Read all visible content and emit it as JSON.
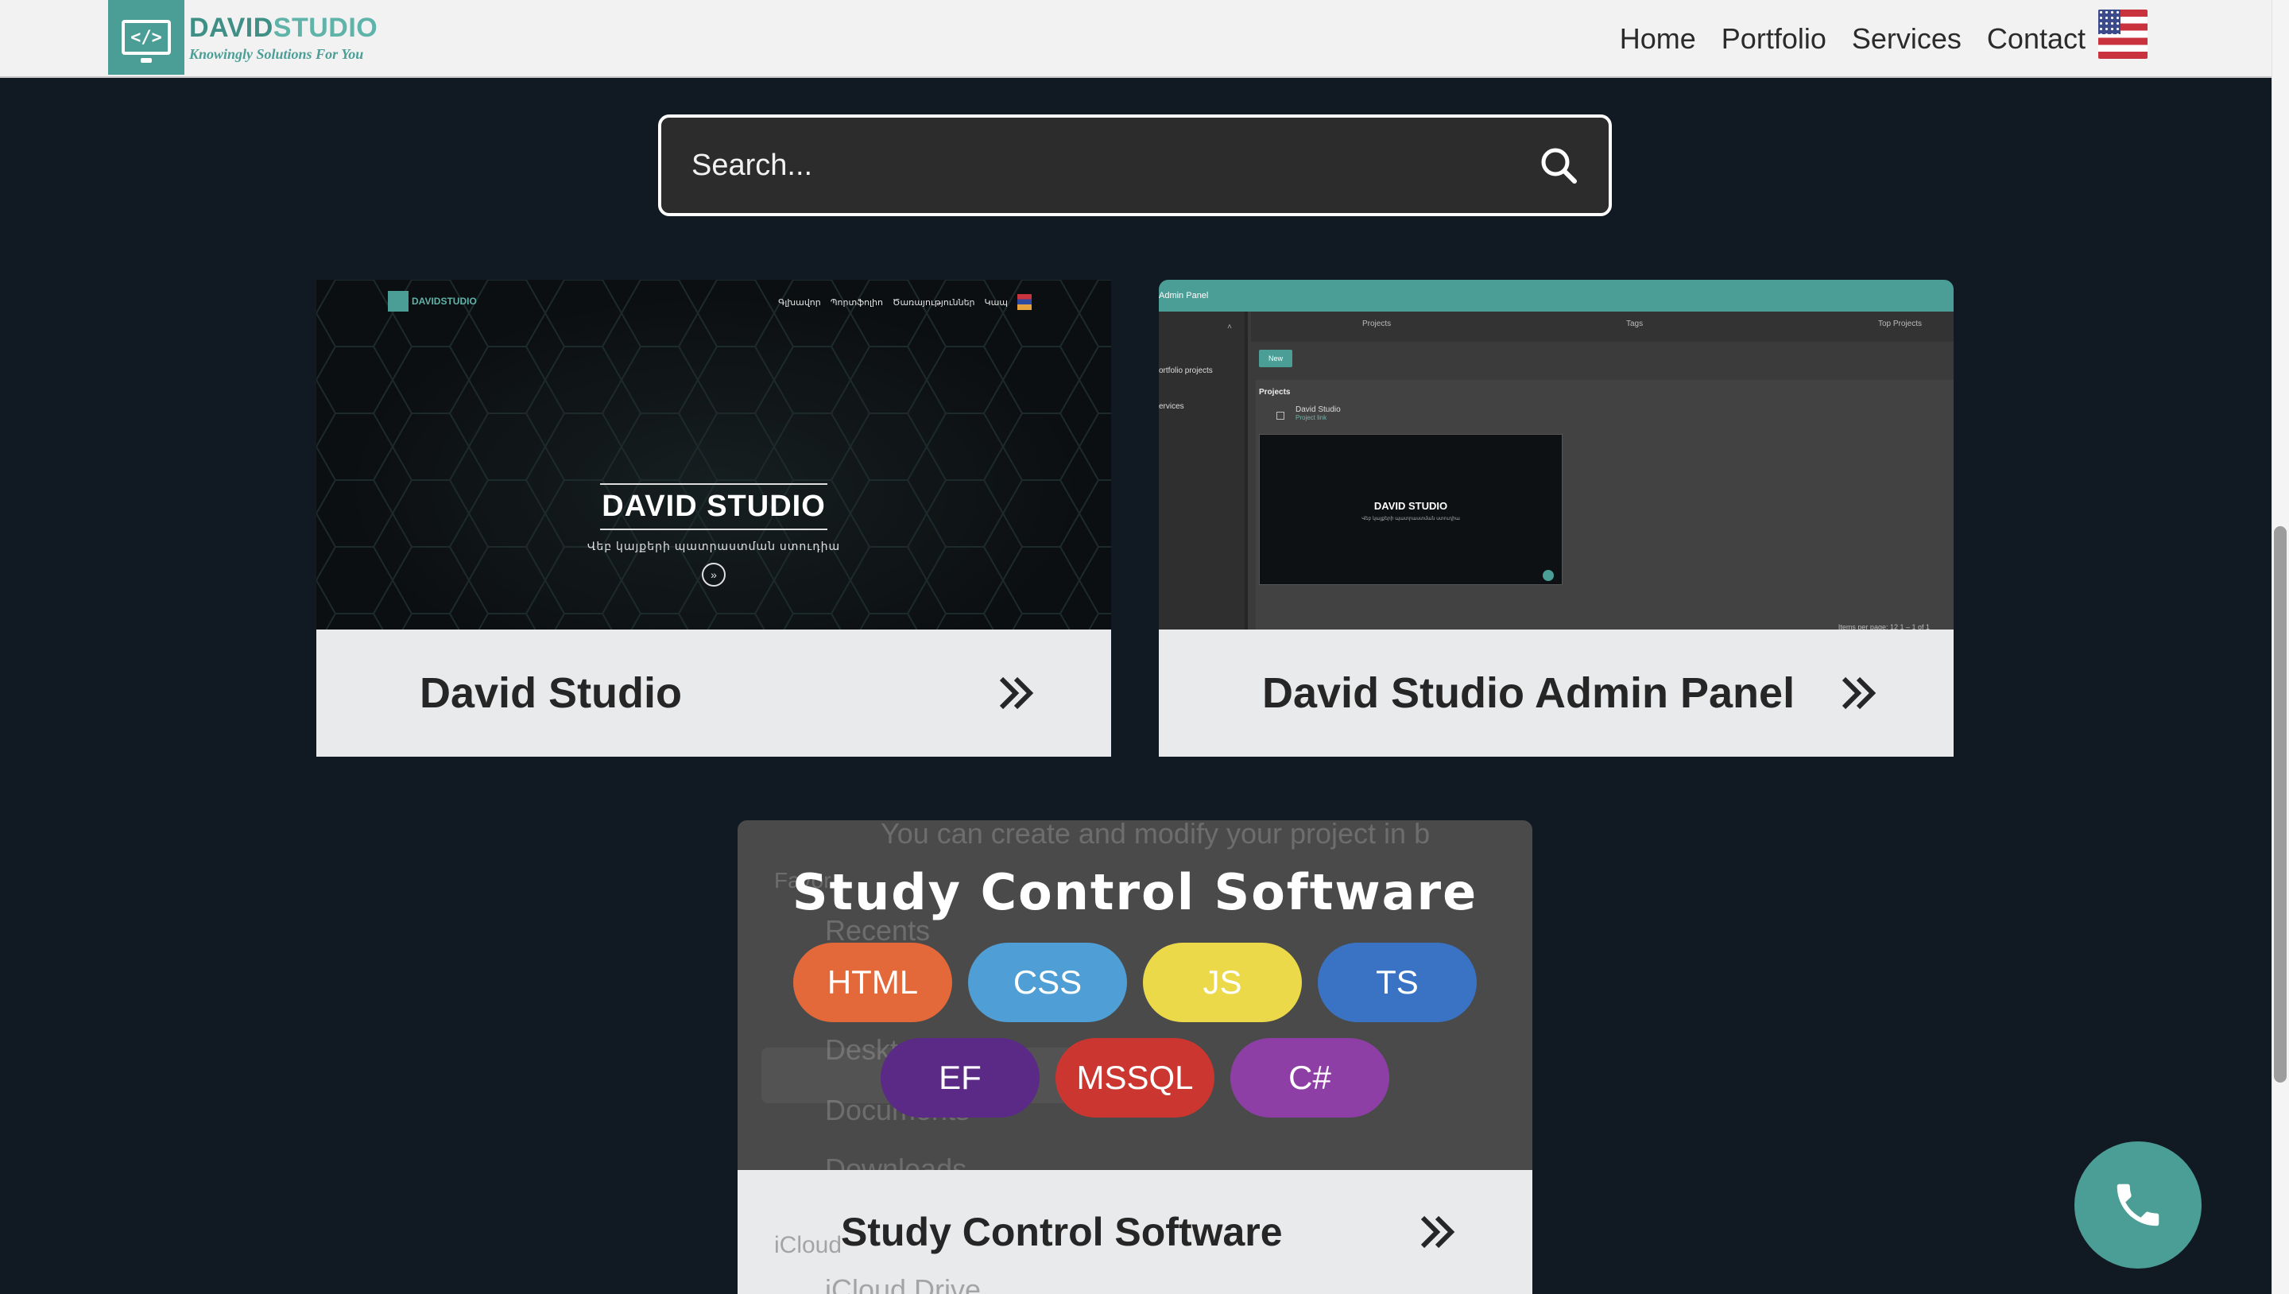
{
  "header": {
    "logo_name_a": "DAVID",
    "logo_name_b": "STUDIO",
    "logo_tagline": "Knowingly Solutions For You",
    "logo_glyph": "</>",
    "nav": [
      "Home",
      "Portfolio",
      "Services",
      "Contact"
    ],
    "language_flag": "us-flag-icon"
  },
  "search": {
    "placeholder": "Search..."
  },
  "projects": [
    {
      "title": "David Studio",
      "preview": {
        "logo_text": "DAVIDSTUDIO",
        "nav": [
          "Գլխավոր",
          "Պորտֆոլիո",
          "Ծառայություններ",
          "Կապ"
        ],
        "hero_title": "DAVID STUDIO",
        "hero_subtitle": "Վեբ կայքերի պատրաստման ստուդիա"
      }
    },
    {
      "title": "David Studio Admin Panel",
      "preview": {
        "bar_title": "Admin Panel",
        "side_items": [
          "ortfolio projects",
          "ervices"
        ],
        "tabs": [
          "Projects",
          "Tags",
          "Top Projects"
        ],
        "new_button": "New",
        "section_label": "Projects",
        "row_title": "David Studio",
        "row_link": "Project link",
        "mini_title": "DAVID STUDIO",
        "mini_subtitle": "Վեբ կայքերի պատրաստման ստուդիա",
        "pager": "Items per page:  12     1 – 1 of 1"
      }
    },
    {
      "title": "Study Control Software",
      "overlay_title": "Study Control Software",
      "background_text": {
        "top": "You can create and modify your project in b",
        "favorites": "Favor",
        "recents": "Recents",
        "desktop": "Deskt",
        "documents": "Documents",
        "downloads": "Downloads",
        "icloud": "iCloud",
        "icloud_drive": "iCloud Drive"
      },
      "tags": [
        {
          "label": "HTML",
          "color": "#e3693b"
        },
        {
          "label": "CSS",
          "color": "#4f9fd6"
        },
        {
          "label": "JS",
          "color": "#ecd94a"
        },
        {
          "label": "TS",
          "color": "#3a73c4"
        },
        {
          "label": "EF",
          "color": "#5b2a86"
        },
        {
          "label": "MSSQL",
          "color": "#cc3631"
        },
        {
          "label": "C#",
          "color": "#8e3fa6"
        }
      ]
    }
  ],
  "colors": {
    "accent": "#4b9e96",
    "background": "#111922"
  }
}
